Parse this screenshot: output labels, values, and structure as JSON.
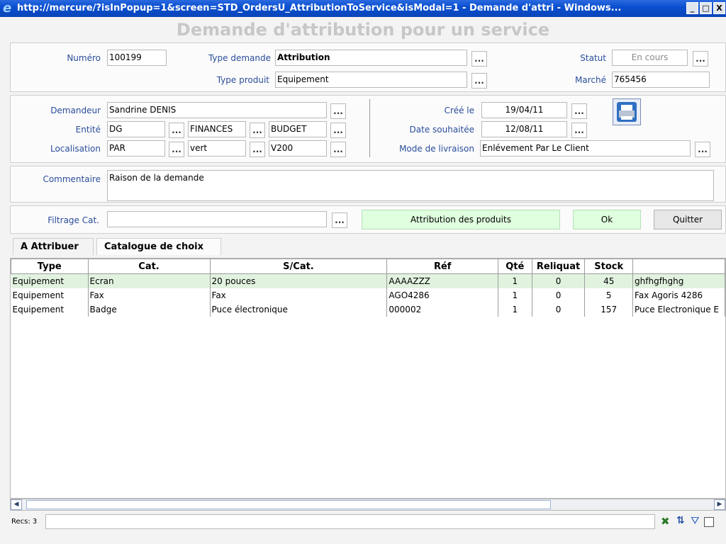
{
  "window": {
    "title": "http://mercure/?isInPopup=1&screen=STD_OrdersU_AttributionToService&isModal=1 - Demande d'attri - Windows...",
    "buttons": [
      "_",
      "□",
      "X"
    ]
  },
  "page": {
    "title": "Demande d'attribution pour un service"
  },
  "header": {
    "numero_label": "Numéro",
    "numero": "100199",
    "type_demande_label": "Type demande",
    "type_demande": "Attribution",
    "statut_label": "Statut",
    "statut": "En cours",
    "type_produit_label": "Type produit",
    "type_produit": "Equipement",
    "marche_label": "Marché",
    "marche": "765456"
  },
  "requester": {
    "demandeur_label": "Demandeur",
    "demandeur": "Sandrine DENIS",
    "entite_label": "Entité",
    "entite": [
      "DG",
      "FINANCES",
      "BUDGET"
    ],
    "localisation_label": "Localisation",
    "localisation": [
      "PAR",
      "vert",
      "V200"
    ],
    "cree_label": "Créé le",
    "cree": "19/04/11",
    "date_souhaitee_label": "Date souhaitée",
    "date_souhaitee": "12/08/11",
    "mode_livraison_label": "Mode de livraison",
    "mode_livraison": "Enlévement Par Le Client"
  },
  "commentaire": {
    "label": "Commentaire",
    "value": "Raison de la demande"
  },
  "filter": {
    "label": "Filtrage Cat.",
    "value": "",
    "attribution_button": "Attribution des produits",
    "ok_button": "Ok",
    "quit_button": "Quitter"
  },
  "dots_label": "...",
  "tabs": [
    {
      "label": "A Attribuer"
    },
    {
      "label": "Catalogue de choix"
    }
  ],
  "grid": {
    "columns": [
      "Type",
      "Cat.",
      "S/Cat.",
      "Réf",
      "Qté",
      "Reliquat",
      "Stock",
      ""
    ],
    "rows": [
      [
        "Equipement",
        "Ecran",
        "20 pouces",
        "AAAAZZZ",
        "1",
        "0",
        "45",
        "ghfhgfhghg"
      ],
      [
        "Equipement",
        "Fax",
        "Fax",
        "AGO4286",
        "1",
        "0",
        "5",
        "Fax Agoris 4286"
      ],
      [
        "Equipement",
        "Badge",
        "Puce électronique",
        "000002",
        "1",
        "0",
        "157",
        "Puce Electronique E"
      ]
    ]
  },
  "status": {
    "recs": "Recs: 3"
  },
  "icons": [
    "ie-icon",
    "printer-icon",
    "excel-export-icon",
    "sort-az-icon",
    "filter-icon"
  ]
}
